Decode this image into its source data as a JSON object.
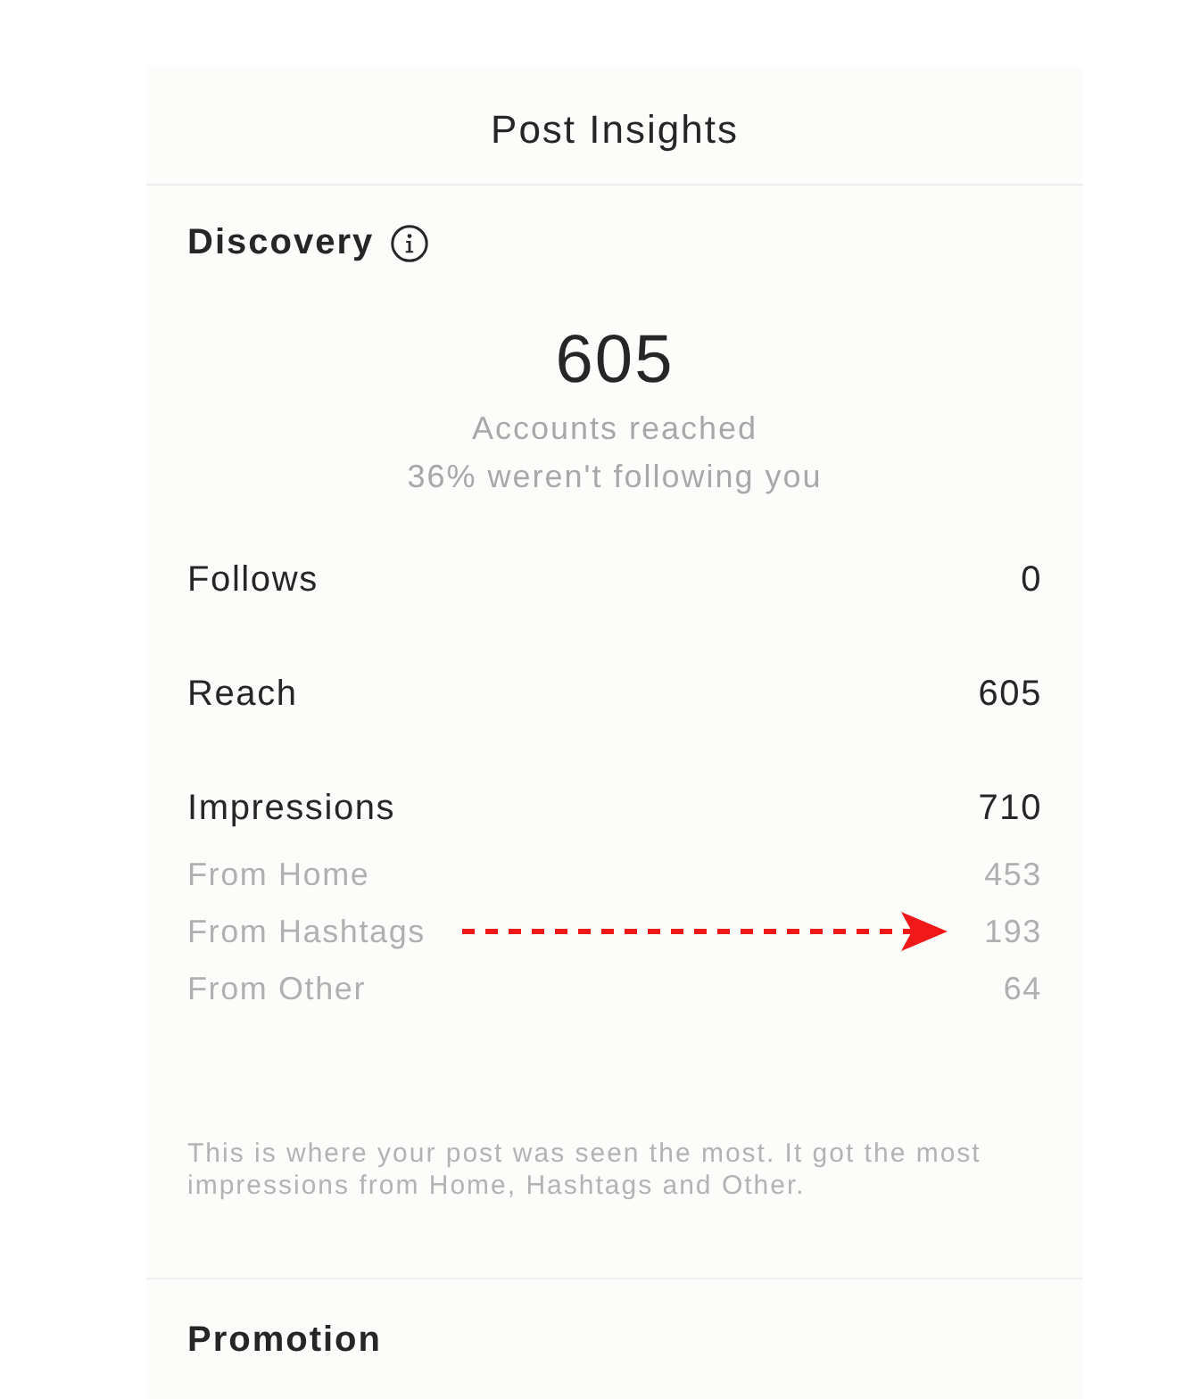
{
  "header": {
    "title": "Post Insights"
  },
  "discovery": {
    "heading": "Discovery",
    "summary": {
      "value": "605",
      "caption": "Accounts reached",
      "subcaption": "36% weren't following you"
    },
    "metrics": [
      {
        "kind": "main",
        "label": "Follows",
        "value": "0",
        "highlighted": false
      },
      {
        "kind": "main",
        "label": "Reach",
        "value": "605",
        "highlighted": false
      },
      {
        "kind": "main",
        "label": "Impressions",
        "value": "710",
        "highlighted": false
      },
      {
        "kind": "sub",
        "label": "From Home",
        "value": "453",
        "highlighted": false
      },
      {
        "kind": "sub",
        "label": "From Hashtags",
        "value": "193",
        "highlighted": true
      },
      {
        "kind": "sub",
        "label": "From Other",
        "value": "64",
        "highlighted": false
      }
    ],
    "note": "This is where your post was seen the most. It got the most impressions from Home, Hashtags and Other."
  },
  "promotion": {
    "heading": "Promotion"
  }
}
